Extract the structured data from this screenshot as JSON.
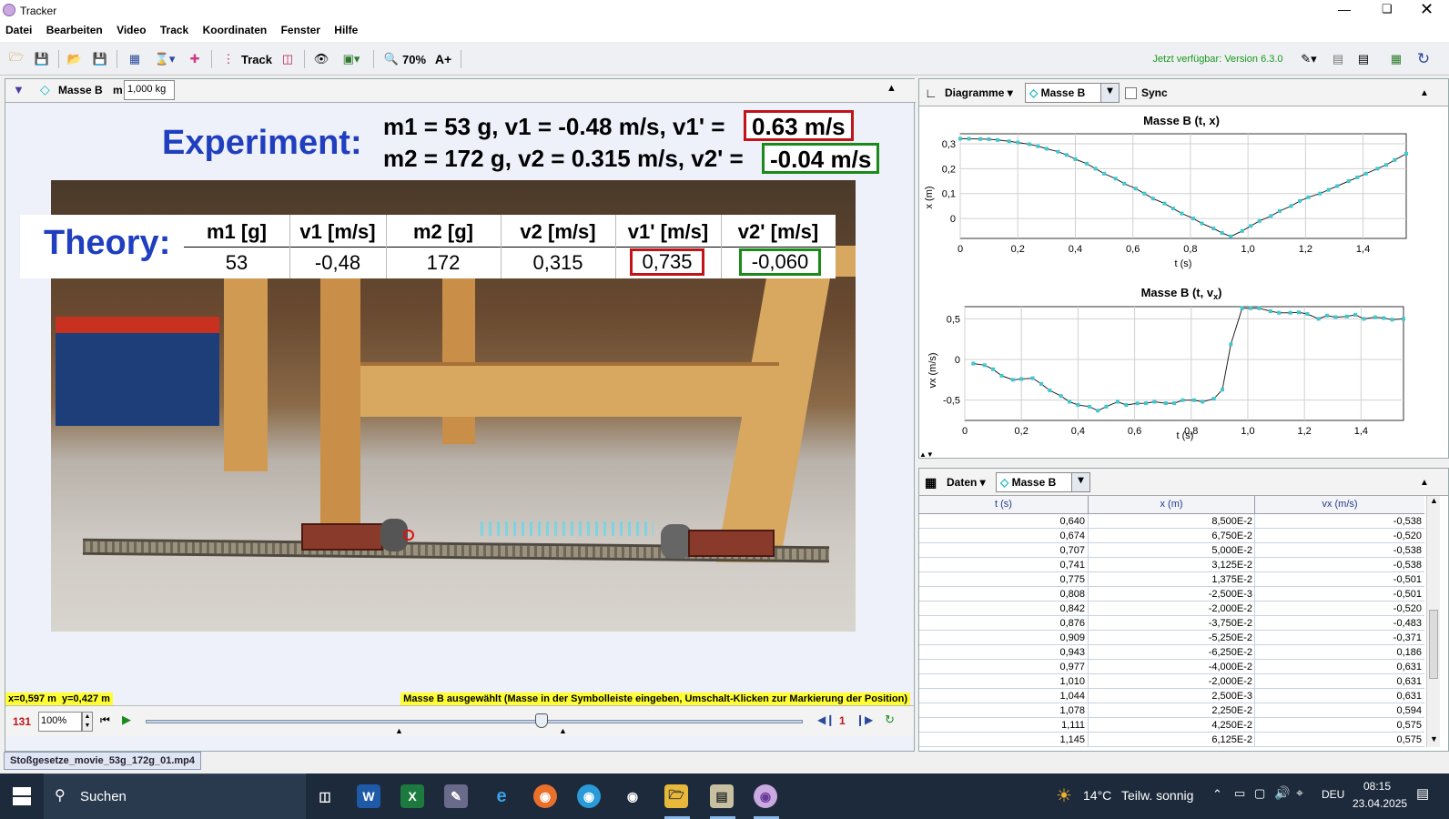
{
  "window": {
    "title": "Tracker"
  },
  "menu": [
    "Datei",
    "Bearbeiten",
    "Video",
    "Track",
    "Koordinaten",
    "Fenster",
    "Hilfe"
  ],
  "toolbar": {
    "track_label": "Track",
    "zoom": "70%",
    "font_label": "A+",
    "update_text": "Jetzt verfügbar: Version 6.3.0"
  },
  "video_panel": {
    "track_name": "Masse B",
    "mass_label": "m",
    "mass_value": "1,000 kg",
    "experiment_label": "Experiment:",
    "exp_line1": "m1 = 53 g, v1 = -0.48 m/s, v1' =",
    "exp_val1": "0.63 m/s",
    "exp_line2": "m2 = 172 g, v2 = 0.315 m/s, v2' =",
    "exp_val2": "-0.04 m/s",
    "theory_label": "Theory:",
    "theory_headers": [
      "m1 [g]",
      "v1 [m/s]",
      "m2 [g]",
      "v2 [m/s]",
      "v1' [m/s]",
      "v2' [m/s]"
    ],
    "theory_values": [
      "53",
      "-0,48",
      "172",
      "0,315",
      "0,735",
      "-0,060"
    ],
    "coords": "x=0,597 m  y=0,427 m",
    "status": "Masse B ausgewählt (Masse in der Symbolleiste eingeben, Umschalt-Klicken zur Markierung der Position)",
    "frame_number": "131",
    "rate": "100%",
    "step_size": "1",
    "file_tab": "Stoßgesetze_movie_53g_172g_01.mp4"
  },
  "plots_panel": {
    "menu_label": "Diagramme",
    "track_label": "Masse B",
    "sync_label": "Sync",
    "plot1_title": "Masse B (t, x)",
    "plot2_title_main": "Masse B (t, v",
    "plot2_title_sub": "x",
    "plot2_title_end": ")",
    "plot1_ylabel": "x (m)",
    "plot2_ylabel": "vx (m/s)",
    "xlabel": "t (s)"
  },
  "chart_data": [
    {
      "type": "scatter",
      "title": "Masse B (t, x)",
      "xlabel": "t (s)",
      "ylabel": "x (m)",
      "xlim": [
        0,
        1.55
      ],
      "ylim": [
        -0.08,
        0.34
      ],
      "x_ticks": [
        "0",
        "0,2",
        "0,4",
        "0,6",
        "0,8",
        "1,0",
        "1,2",
        "1,4"
      ],
      "y_ticks": [
        "0,3",
        "0,2",
        "0,1",
        "0"
      ],
      "points": [
        [
          0,
          0.32
        ],
        [
          0.03,
          0.32
        ],
        [
          0.07,
          0.319
        ],
        [
          0.1,
          0.318
        ],
        [
          0.13,
          0.315
        ],
        [
          0.17,
          0.31
        ],
        [
          0.2,
          0.305
        ],
        [
          0.24,
          0.298
        ],
        [
          0.27,
          0.29
        ],
        [
          0.3,
          0.28
        ],
        [
          0.34,
          0.268
        ],
        [
          0.37,
          0.255
        ],
        [
          0.4,
          0.238
        ],
        [
          0.44,
          0.22
        ],
        [
          0.47,
          0.2
        ],
        [
          0.5,
          0.18
        ],
        [
          0.54,
          0.16
        ],
        [
          0.57,
          0.14
        ],
        [
          0.61,
          0.12
        ],
        [
          0.64,
          0.1
        ],
        [
          0.67,
          0.08
        ],
        [
          0.71,
          0.06
        ],
        [
          0.74,
          0.04
        ],
        [
          0.77,
          0.02
        ],
        [
          0.81,
          0
        ],
        [
          0.84,
          -0.02
        ],
        [
          0.88,
          -0.04
        ],
        [
          0.91,
          -0.058
        ],
        [
          0.94,
          -0.072
        ],
        [
          0.98,
          -0.05
        ],
        [
          1.01,
          -0.03
        ],
        [
          1.04,
          -0.01
        ],
        [
          1.08,
          0.01
        ],
        [
          1.11,
          0.03
        ],
        [
          1.15,
          0.05
        ],
        [
          1.18,
          0.07
        ],
        [
          1.21,
          0.085
        ],
        [
          1.25,
          0.1
        ],
        [
          1.28,
          0.115
        ],
        [
          1.31,
          0.13
        ],
        [
          1.35,
          0.15
        ],
        [
          1.38,
          0.165
        ],
        [
          1.41,
          0.18
        ],
        [
          1.45,
          0.2
        ],
        [
          1.48,
          0.215
        ],
        [
          1.51,
          0.235
        ],
        [
          1.55,
          0.26
        ]
      ]
    },
    {
      "type": "scatter",
      "title": "Masse B (t, vx)",
      "xlabel": "t (s)",
      "ylabel": "vx (m/s)",
      "xlim": [
        0,
        1.55
      ],
      "ylim": [
        -0.75,
        0.65
      ],
      "x_ticks": [
        "0",
        "0,2",
        "0,4",
        "0,6",
        "0,8",
        "1,0",
        "1,2",
        "1,4"
      ],
      "y_ticks": [
        "0,5",
        "0",
        "-0,5"
      ],
      "points": [
        [
          0.03,
          -0.05
        ],
        [
          0.07,
          -0.07
        ],
        [
          0.1,
          -0.12
        ],
        [
          0.13,
          -0.2
        ],
        [
          0.17,
          -0.25
        ],
        [
          0.2,
          -0.24
        ],
        [
          0.24,
          -0.23
        ],
        [
          0.27,
          -0.3
        ],
        [
          0.3,
          -0.38
        ],
        [
          0.34,
          -0.45
        ],
        [
          0.37,
          -0.52
        ],
        [
          0.4,
          -0.56
        ],
        [
          0.44,
          -0.58
        ],
        [
          0.47,
          -0.63
        ],
        [
          0.5,
          -0.58
        ],
        [
          0.54,
          -0.52
        ],
        [
          0.57,
          -0.56
        ],
        [
          0.61,
          -0.54
        ],
        [
          0.64,
          -0.538
        ],
        [
          0.67,
          -0.52
        ],
        [
          0.71,
          -0.538
        ],
        [
          0.74,
          -0.538
        ],
        [
          0.77,
          -0.501
        ],
        [
          0.81,
          -0.501
        ],
        [
          0.84,
          -0.52
        ],
        [
          0.88,
          -0.483
        ],
        [
          0.91,
          -0.371
        ],
        [
          0.94,
          0.186
        ],
        [
          0.98,
          0.631
        ],
        [
          1.01,
          0.631
        ],
        [
          1.04,
          0.631
        ],
        [
          1.08,
          0.594
        ],
        [
          1.11,
          0.575
        ],
        [
          1.15,
          0.575
        ],
        [
          1.18,
          0.58
        ],
        [
          1.21,
          0.56
        ],
        [
          1.25,
          0.5
        ],
        [
          1.28,
          0.54
        ],
        [
          1.31,
          0.52
        ],
        [
          1.35,
          0.53
        ],
        [
          1.38,
          0.55
        ],
        [
          1.41,
          0.5
        ],
        [
          1.45,
          0.52
        ],
        [
          1.48,
          0.51
        ],
        [
          1.51,
          0.49
        ],
        [
          1.55,
          0.5
        ]
      ]
    }
  ],
  "data_panel": {
    "menu_label": "Daten",
    "track_label": "Masse B",
    "headers": [
      "t (s)",
      "x (m)",
      "vx (m/s)"
    ],
    "rows": [
      [
        "0,640",
        "8,500E-2",
        "-0,538"
      ],
      [
        "0,674",
        "6,750E-2",
        "-0,520"
      ],
      [
        "0,707",
        "5,000E-2",
        "-0,538"
      ],
      [
        "0,741",
        "3,125E-2",
        "-0,538"
      ],
      [
        "0,775",
        "1,375E-2",
        "-0,501"
      ],
      [
        "0,808",
        "-2,500E-3",
        "-0,501"
      ],
      [
        "0,842",
        "-2,000E-2",
        "-0,520"
      ],
      [
        "0,876",
        "-3,750E-2",
        "-0,483"
      ],
      [
        "0,909",
        "-5,250E-2",
        "-0,371"
      ],
      [
        "0,943",
        "-6,250E-2",
        "0,186"
      ],
      [
        "0,977",
        "-4,000E-2",
        "0,631"
      ],
      [
        "1,010",
        "-2,000E-2",
        "0,631"
      ],
      [
        "1,044",
        "2,500E-3",
        "0,631"
      ],
      [
        "1,078",
        "2,250E-2",
        "0,594"
      ],
      [
        "1,111",
        "4,250E-2",
        "0,575"
      ],
      [
        "1,145",
        "6,125E-2",
        "0,575"
      ]
    ]
  },
  "taskbar": {
    "search": "Suchen",
    "weather_temp": "14°C",
    "weather_text": "Teilw. sonnig",
    "lang": "DEU",
    "time": "08:15",
    "date": "23.04.2025"
  },
  "colors": {
    "accent_blue": "#1f3fbf",
    "red_box": "#c0141a",
    "green_box": "#1a8a1a",
    "status_yellow": "#ffff33"
  }
}
